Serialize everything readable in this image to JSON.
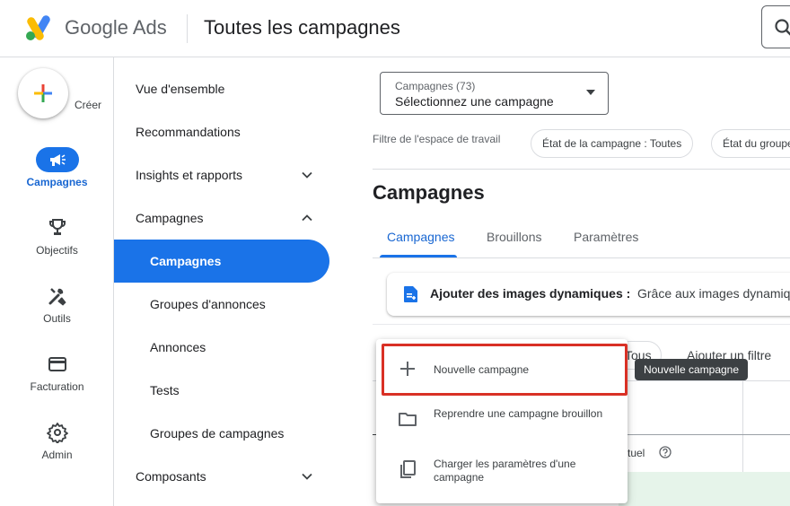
{
  "header": {
    "brand": "Google Ads",
    "page_title": "Toutes les campagnes"
  },
  "rail": {
    "create_label": "Créer",
    "items": [
      {
        "label": "Campagnes",
        "icon": "megaphone-icon",
        "active": true
      },
      {
        "label": "Objectifs",
        "icon": "trophy-icon",
        "active": false
      },
      {
        "label": "Outils",
        "icon": "tools-icon",
        "active": false
      },
      {
        "label": "Facturation",
        "icon": "credit-card-icon",
        "active": false
      },
      {
        "label": "Admin",
        "icon": "gear-icon",
        "active": false
      }
    ]
  },
  "nav": {
    "items": [
      {
        "label": "Vue d'ensemble",
        "level": 1
      },
      {
        "label": "Recommandations",
        "level": 1
      },
      {
        "label": "Insights et rapports",
        "level": 1,
        "chevron": "down"
      },
      {
        "label": "Campagnes",
        "level": 1,
        "chevron": "up"
      },
      {
        "label": "Campagnes",
        "level": 2,
        "active": true
      },
      {
        "label": "Groupes d'annonces",
        "level": 2
      },
      {
        "label": "Annonces",
        "level": 2
      },
      {
        "label": "Tests",
        "level": 2
      },
      {
        "label": "Groupes de campagnes",
        "level": 2
      },
      {
        "label": "Composants",
        "level": 1,
        "chevron": "down"
      }
    ]
  },
  "main": {
    "campaign_select": {
      "count": "Campagnes (73)",
      "value": "Sélectionnez une campagne"
    },
    "filter_label": "Filtre de l'espace de travail",
    "chips": [
      "État de la campagne : Toutes",
      "État du groupe"
    ],
    "section_title": "Campagnes",
    "tabs": [
      {
        "label": "Campagnes",
        "active": true
      },
      {
        "label": "Brouillons",
        "active": false
      },
      {
        "label": "Paramètres",
        "active": false
      }
    ],
    "banner": {
      "title": "Ajouter des images dynamiques :",
      "text": "Grâce aux images dynamiques"
    },
    "filter_chip_all": "Tous",
    "add_filter": "Ajouter un filtre",
    "column_label": "ctuel"
  },
  "menu": {
    "items": [
      {
        "label": "Nouvelle campagne",
        "icon": "plus-icon"
      },
      {
        "label": "Reprendre une campagne brouillon",
        "icon": "folder-icon"
      },
      {
        "label": "Charger les paramètres d'une campagne",
        "icon": "copy-icon"
      }
    ]
  },
  "tooltip": "Nouvelle campagne",
  "colors": {
    "accent": "#1a73e8",
    "highlight_border": "#d93025",
    "tooltip_bg": "#3c4043"
  }
}
